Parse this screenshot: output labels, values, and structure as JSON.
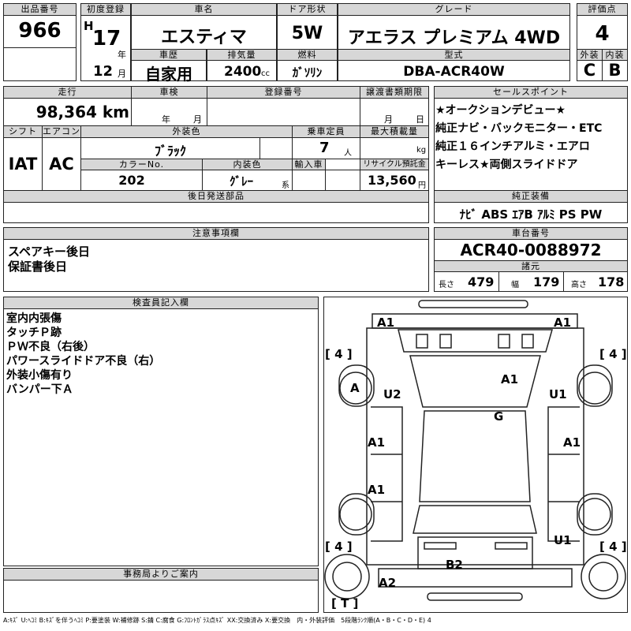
{
  "header": {
    "lot_label": "出品番号",
    "lot_number": "966",
    "reg_label": "初度登録",
    "era_mark": "H",
    "reg_year": "17",
    "year_unit": "年",
    "reg_month": "12",
    "month_unit": "月",
    "name_label": "車名",
    "car_name": "エスティマ",
    "door_label": "ドア形状",
    "door": "5W",
    "grade_label": "グレード",
    "grade": "アエラス プレミアム 4WD",
    "score_label": "評価点",
    "score": "4",
    "history_label": "車歴",
    "history": "自家用",
    "disp_label": "排気量",
    "displacement": "2400",
    "disp_unit": "cc",
    "fuel_label": "燃料",
    "fuel": "ｶﾞｿﾘﾝ",
    "model_label": "型式",
    "model": "DBA-ACR40W",
    "ext_label": "外装",
    "ext_grade": "C",
    "int_label": "内装",
    "int_grade": "B"
  },
  "mid": {
    "mileage_label": "走行",
    "mileage": "98,364 km",
    "inspection_label": "車検",
    "insp_year_unit": "年",
    "insp_month_unit": "月",
    "plate_label": "登録番号",
    "transfer_label": "譲渡書類期限",
    "transfer_month_unit": "月",
    "transfer_day_unit": "日",
    "shift_label": "シフト",
    "shift": "IAT",
    "ac_label": "エアコン",
    "ac": "AC",
    "color_label": "外装色",
    "color": "ﾌﾞﾗｯｸ",
    "seats_label": "乗車定員",
    "seats": "7",
    "seats_unit": "人",
    "load_label": "最大積載量",
    "load_unit": "kg",
    "colorno_label": "カラーNo.",
    "colorno": "202",
    "intcolor_label": "内装色",
    "intcolor": "ｸﾞﾚｰ",
    "intcolor_unit": "系",
    "import_label": "輸入車",
    "recycle_label": "リサイクル預託金",
    "recycle": "13,560",
    "recycle_unit": "円",
    "later_label": "後日発送部品"
  },
  "sales": {
    "label": "セールスポイント",
    "lines": [
      "★オークションデビュー★",
      "純正ナビ・バックモニター・ETC",
      "純正１６インチアルミ・エアロ",
      "キーレス★両側スライドドア"
    ]
  },
  "equipment": {
    "label": "純正装備",
    "value": "ﾅﾋﾞ ABS ｴｱB ｱﾙﾐ PS PW"
  },
  "notes": {
    "label": "注意事項欄",
    "lines": [
      "スペアキー後日",
      "保証書後日"
    ]
  },
  "chassis": {
    "label": "車台番号",
    "value": "ACR40-0088972",
    "dims_label": "諸元",
    "length_label": "長さ",
    "length": "479",
    "width_label": "幅",
    "width": "179",
    "height_label": "高さ",
    "height": "178"
  },
  "inspector": {
    "label": "検査員記入欄",
    "lines": [
      "室内内張傷",
      "タッチＰ跡",
      "ＰＷ不良（右後）",
      "パワースライドドア不良（右）",
      "外装小傷有り",
      "バンパー下Ａ"
    ]
  },
  "office": {
    "label": "事務局よりご案内"
  },
  "diagram": {
    "marks": {
      "front_left": "A1",
      "front_right": "A1",
      "tire_fl": "4",
      "tire_fr": "4",
      "tire_rl": "4",
      "tire_rr": "4",
      "tire_spare": "T",
      "left_front_wheel": "A",
      "u2": "U2",
      "roof": "A1",
      "u1_front": "U1",
      "glass": "G",
      "left_door_front": "A1",
      "right_door_front": "A1",
      "left_door_rear": "A1",
      "u1_rear": "U1",
      "rear_b2": "B2",
      "rear_a2": "A2"
    }
  },
  "legend": "A:ｷｽﾞ U:ﾍｺﾐ B:ｷｽﾞを伴うﾍｺﾐ P:要塗装 W:補修跡 S:錆 C:腐食 G:ﾌﾛﾝﾄｶﾞﾗｽ点ｷｽﾞ XX:交換済み X:要交換　内・外装評価　5段階ﾗﾝｸ順(A・B・C・D・E) 4"
}
